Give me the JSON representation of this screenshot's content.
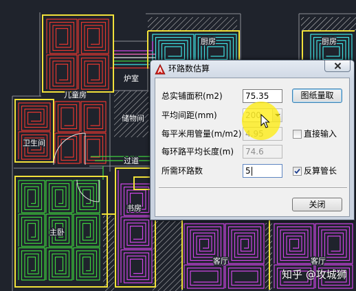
{
  "drawing": {
    "rooms": {
      "boiler_room": "炉室",
      "children_room": "儿童房",
      "bathroom": "卫生间",
      "storage_room": "储物间",
      "corridor": "过道",
      "master_bedroom": "主卧",
      "study": "书房",
      "kitchen_left": "厨房",
      "kitchen_right": "厨房",
      "living_room_left": "客厅",
      "living_room_right": "客厅"
    },
    "colors": {
      "background": "#1f232c",
      "wall_outline": "#f2e23a",
      "wall": "#8c8f96",
      "door": "#e8e8e8",
      "pipe_red": "#e6372f",
      "pipe_green": "#3ed23e",
      "pipe_magenta": "#cf45e6",
      "pipe_cyan": "#3fe2e2",
      "pipe_pink": "#ff6fc8",
      "hatch": "#d6d6d6"
    }
  },
  "dialog": {
    "title": "环路数估算",
    "title_icon": "autocad-icon",
    "close_icon": "close-icon",
    "fields": [
      {
        "label": "总实铺面积(m2)",
        "value": "75.35",
        "enabled": true
      },
      {
        "label": "平均间距(mm)",
        "value": "200",
        "enabled": false,
        "control": "dropdown"
      },
      {
        "label": "每平米用管量(m/m2)",
        "value": "4.95",
        "enabled": false
      },
      {
        "label": "每环路平均长度(m)",
        "value": "74.6",
        "enabled": false
      },
      {
        "label": "所需环路数",
        "value": "5",
        "enabled": true,
        "focused": true
      }
    ],
    "measure_button": "图纸量取",
    "direct_input": {
      "label": "直接输入",
      "checked": false
    },
    "reverse_pipe_length": {
      "label": "反算管长",
      "checked": true
    },
    "close_button": "关闭"
  },
  "cursor": {
    "icon": "arrow-cursor-icon",
    "highlight_color": "#ffec00"
  },
  "watermark": "知乎 @攻城狮"
}
